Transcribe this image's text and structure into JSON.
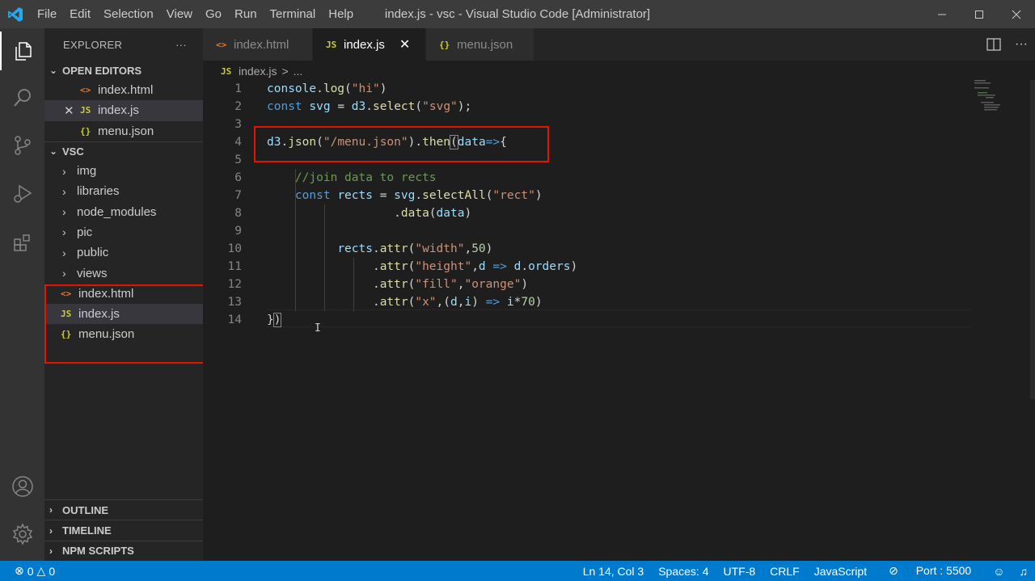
{
  "window": {
    "title": "index.js - vsc - Visual Studio Code [Administrator]",
    "menu": [
      "File",
      "Edit",
      "Selection",
      "View",
      "Go",
      "Run",
      "Terminal",
      "Help"
    ]
  },
  "sidebar": {
    "header": "EXPLORER",
    "more": "···",
    "open_editors": {
      "label": "OPEN EDITORS",
      "items": [
        {
          "icon": "<>",
          "name": "index.html"
        },
        {
          "icon": "JS",
          "name": "index.js"
        },
        {
          "icon": "{}",
          "name": "menu.json"
        }
      ]
    },
    "folder": {
      "label": "VSC",
      "folders": [
        "img",
        "libraries",
        "node_modules",
        "pic",
        "public",
        "views"
      ],
      "files": [
        {
          "icon": "<>",
          "name": "index.html"
        },
        {
          "icon": "JS",
          "name": "index.js"
        },
        {
          "icon": "{}",
          "name": "menu.json"
        }
      ]
    },
    "bottom_sections": [
      "OUTLINE",
      "TIMELINE",
      "NPM SCRIPTS"
    ]
  },
  "tabs": [
    {
      "icon": "<>",
      "label": "index.html"
    },
    {
      "icon": "JS",
      "label": "index.js"
    },
    {
      "icon": "{}",
      "label": "menu.json"
    }
  ],
  "breadcrumb": {
    "icon": "JS",
    "file": "index.js",
    "sep": ">",
    "rest": "..."
  },
  "editor": {
    "line_numbers": [
      "1",
      "2",
      "3",
      "4",
      "5",
      "6",
      "7",
      "8",
      "9",
      "10",
      "11",
      "12",
      "13",
      "14"
    ]
  },
  "statusbar": {
    "errors": "0",
    "warnings": "0",
    "position": "Ln 14, Col 3",
    "spaces": "Spaces: 4",
    "encoding": "UTF-8",
    "eol": "CRLF",
    "language": "JavaScript",
    "port": "Port : 5500"
  },
  "colors": {
    "accent": "#007acc",
    "highlight_box": "#e51400"
  }
}
